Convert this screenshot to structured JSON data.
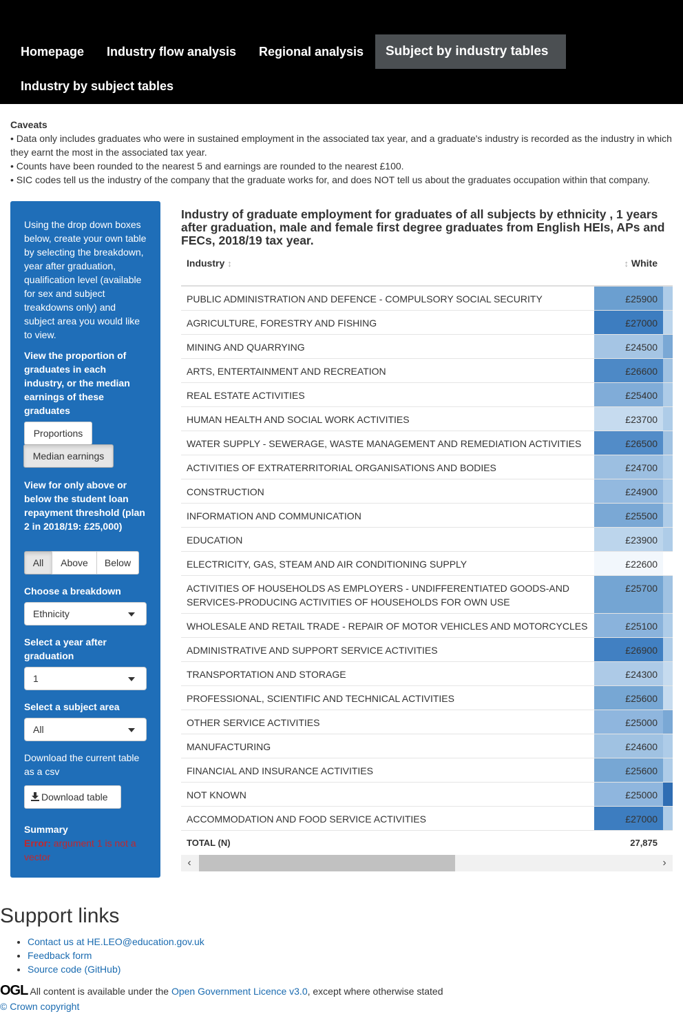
{
  "nav": {
    "items": [
      "Homepage",
      "Industry flow analysis",
      "Regional analysis",
      "Subject by industry tables",
      "Industry by subject tables"
    ]
  },
  "caveats": {
    "title": "Caveats",
    "lines": [
      "• Data only includes graduates who were in sustained employment in the associated tax year, and a graduate's industry is recorded as the industry in which they earnt the most in the associated tax year.",
      "• Counts have been rounded to the nearest 5 and earnings are rounded to the nearest £100.",
      "• SIC codes tell us the industry of the company that the graduate works for, and does NOT tell us about the graduates occupation within that company."
    ]
  },
  "sidebar": {
    "intro": "Using the drop down boxes below, create your own table by selecting the breakdown, year after graduation, qualification level (available for sex and subject treakdowns only) and subject area you would like to view.",
    "view_label": "View the proportion of graduates in each industry, or the median earnings of these graduates",
    "btn_proportions": "Proportions",
    "btn_median": "Median earnings",
    "threshold_label": "View for only above or below the student loan repayment threshold (plan 2 in 2018/19: £25,000)",
    "threshold_options": [
      "All",
      "Above",
      "Below"
    ],
    "breakdown_label": "Choose a breakdown",
    "breakdown_value": "Ethnicity",
    "year_label": "Select a year after graduation",
    "year_value": "1",
    "subject_label": "Select a subject area",
    "subject_value": "All",
    "download_label": "Download the current table as a csv",
    "download_btn": "Download table",
    "summary_label": "Summary",
    "error_prefix": "Error:",
    "error_text": " argument 1 is not a vector"
  },
  "table": {
    "title": "Industry of graduate employment for graduates of all subjects by ethnicity , 1 years after graduation, male and female first degree graduates from English HEIs, APs and FECs, 2018/19 tax year.",
    "col_industry": "Industry",
    "col_white": "White",
    "sort_glyph": "↕",
    "rows": [
      {
        "industry": "PUBLIC ADMINISTRATION AND DEFENCE - COMPULSORY SOCIAL SECURITY",
        "white": "£25900",
        "bg": "#6b9fd0",
        "next": "#aecce8"
      },
      {
        "industry": "AGRICULTURE, FORESTRY AND FISHING",
        "white": "£27000",
        "bg": "#3d7dc0",
        "next": "#bcd5ec"
      },
      {
        "industry": "MINING AND QUARRYING",
        "white": "£24500",
        "bg": "#a5c5e4",
        "next": "#7aa8d5"
      },
      {
        "industry": "ARTS, ENTERTAINMENT AND RECREATION",
        "white": "£26600",
        "bg": "#4d89c6",
        "next": "#a0c2e2"
      },
      {
        "industry": "REAL ESTATE ACTIVITIES",
        "white": "£25400",
        "bg": "#80acd8",
        "next": "#aecce8"
      },
      {
        "industry": "HUMAN HEALTH AND SOCIAL WORK ACTIVITIES",
        "white": "£23700",
        "bg": "#c6dbef",
        "next": "#aecce8"
      },
      {
        "industry": "WATER SUPPLY - SEWERAGE, WASTE MANAGEMENT AND REMEDIATION ACTIVITIES",
        "white": "£26500",
        "bg": "#528cc8",
        "next": "#a0c2e2"
      },
      {
        "industry": "ACTIVITIES OF EXTRATERRITORIAL ORGANISATIONS AND BODIES",
        "white": "£24700",
        "bg": "#9cbfe1",
        "next": "#aecce8"
      },
      {
        "industry": "CONSTRUCTION",
        "white": "£24900",
        "bg": "#93b9df",
        "next": "#aecce8"
      },
      {
        "industry": "INFORMATION AND COMMUNICATION",
        "white": "£25500",
        "bg": "#7aa8d5",
        "next": "#aecce8"
      },
      {
        "industry": "EDUCATION",
        "white": "£23900",
        "bg": "#bcd5ec",
        "next": "#aecce8"
      },
      {
        "industry": "ELECTRICITY, GAS, STEAM AND AIR CONDITIONING SUPPLY",
        "white": "£22600",
        "bg": "#f2f7fc",
        "next": "#ffffff"
      },
      {
        "industry": "ACTIVITIES OF HOUSEHOLDS AS EMPLOYERS - UNDIFFERENTIATED GOODS-AND SERVICES-PRODUCING ACTIVITIES OF HOUSEHOLDS FOR OWN USE",
        "white": "£25700",
        "bg": "#74a5d3",
        "next": "#a0c2e2"
      },
      {
        "industry": "WHOLESALE AND RETAIL TRADE - REPAIR OF MOTOR VEHICLES AND MOTORCYCLES",
        "white": "£25100",
        "bg": "#8ab3dc",
        "next": "#aecce8"
      },
      {
        "industry": "ADMINISTRATIVE AND SUPPORT SERVICE ACTIVITIES",
        "white": "£26900",
        "bg": "#4180c2",
        "next": "#aecce8"
      },
      {
        "industry": "TRANSPORTATION AND STORAGE",
        "white": "£24300",
        "bg": "#adcae7",
        "next": "#c6dbef"
      },
      {
        "industry": "PROFESSIONAL, SCIENTIFIC AND TECHNICAL ACTIVITIES",
        "white": "£25600",
        "bg": "#77a7d4",
        "next": "#c6dbef"
      },
      {
        "industry": "OTHER SERVICE ACTIVITIES",
        "white": "£25000",
        "bg": "#8fb6de",
        "next": "#7aa8d5"
      },
      {
        "industry": "MANUFACTURING",
        "white": "£24600",
        "bg": "#a0c2e2",
        "next": "#aecce8"
      },
      {
        "industry": "FINANCIAL AND INSURANCE ACTIVITIES",
        "white": "£25600",
        "bg": "#77a7d4",
        "next": "#aecce8"
      },
      {
        "industry": "NOT KNOWN",
        "white": "£25000",
        "bg": "#8fb6de",
        "next": "#2f6db3"
      },
      {
        "industry": "ACCOMMODATION AND FOOD SERVICE ACTIVITIES",
        "white": "£27000",
        "bg": "#3d7dc0",
        "next": "#aecce8"
      }
    ],
    "total_label": "TOTAL (N)",
    "total_white": "27,875"
  },
  "footer": {
    "support_title": "Support links",
    "links": [
      "Contact us at HE.LEO@education.gov.uk",
      "Feedback form",
      "Source code (GitHub)"
    ],
    "ogl_logo": "OGL",
    "ogl_text_1": "All content is available under the ",
    "ogl_link": "Open Government Licence v3.0",
    "ogl_text_2": ", except where otherwise stated",
    "copyright": "© Crown copyright"
  }
}
